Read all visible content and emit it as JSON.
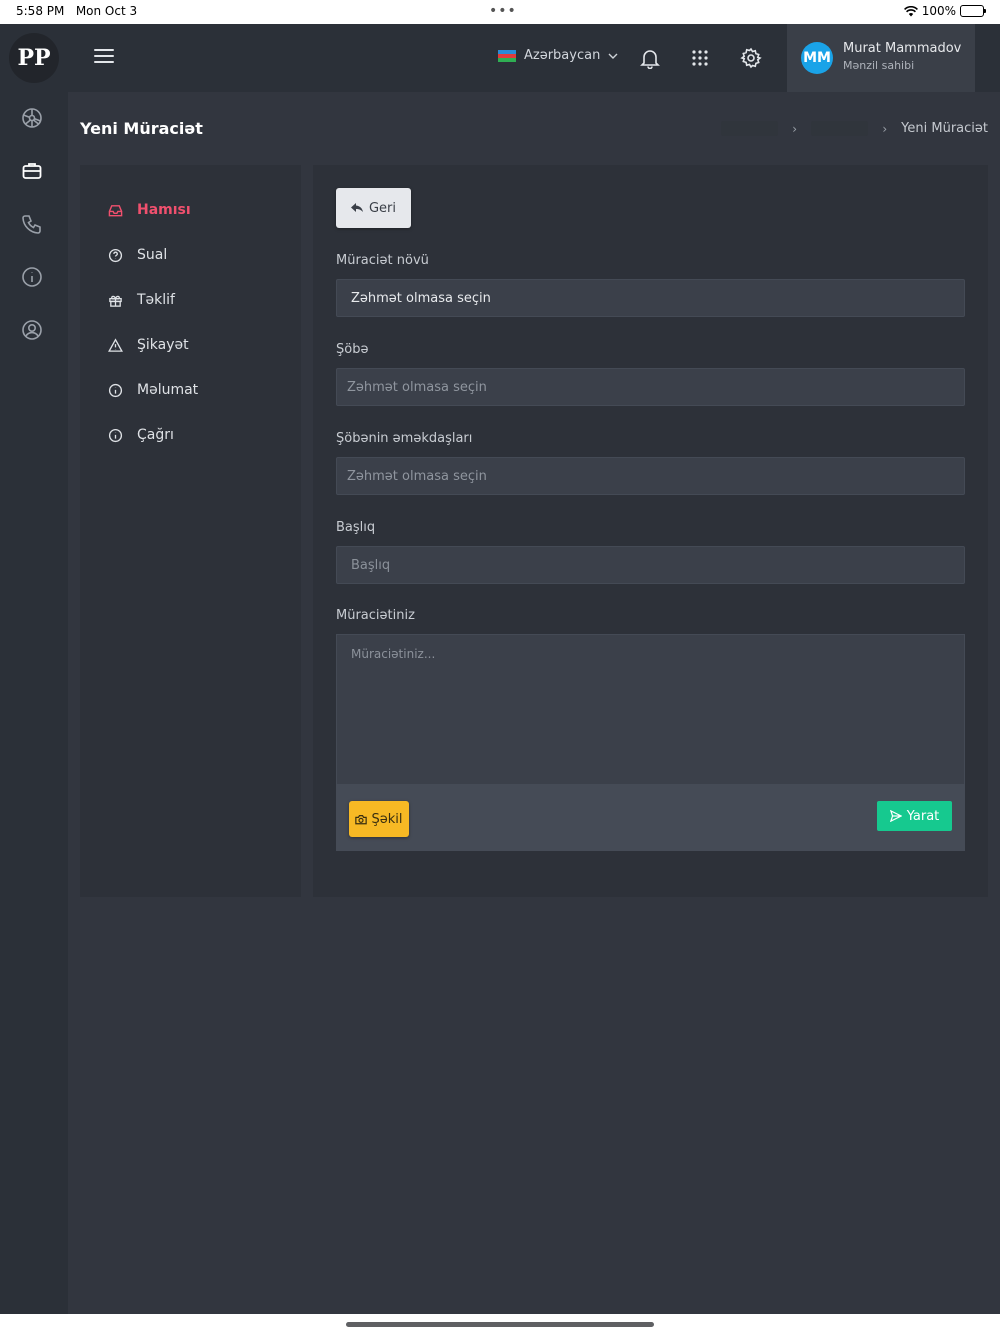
{
  "status_bar": {
    "time": "5:58 PM",
    "date": "Mon Oct 3",
    "battery": "100%"
  },
  "logo": {
    "text": "PP"
  },
  "rail": {
    "icons": [
      "dashboard-icon",
      "briefcase-icon",
      "phone-icon",
      "info-icon",
      "user-circle-icon"
    ]
  },
  "topbar": {
    "language": "Azərbaycan",
    "user": {
      "initials": "MM",
      "name": "Murat Mammadov",
      "role": "Mənzil sahibi"
    }
  },
  "page": {
    "title": "Yeni Müraciət",
    "breadcrumb": {
      "current": "Yeni Müraciət"
    }
  },
  "filters": {
    "items": [
      {
        "label": "Hamısı",
        "icon": "inbox-icon",
        "active": true
      },
      {
        "label": "Sual",
        "icon": "question-circle-icon",
        "active": false
      },
      {
        "label": "Təklif",
        "icon": "gift-icon",
        "active": false
      },
      {
        "label": "Şikayət",
        "icon": "warning-triangle-icon",
        "active": false
      },
      {
        "label": "Məlumat",
        "icon": "info-circle-icon",
        "active": false
      },
      {
        "label": "Çağrı",
        "icon": "info-circle-icon",
        "active": false
      }
    ]
  },
  "form": {
    "back_label": "Geri",
    "type_label": "Müraciət növü",
    "type_value": "Zəhmət olmasa seçin",
    "department_label": "Şöbə",
    "department_placeholder": "Zəhmət olmasa seçin",
    "employees_label": "Şöbənin əməkdaşları",
    "employees_placeholder": "Zəhmət olmasa seçin",
    "subject_label": "Başlıq",
    "subject_placeholder": "Başlıq",
    "message_label": "Müraciətiniz",
    "message_placeholder": "Müraciətiniz...",
    "photo_label": "Şəkil",
    "create_label": "Yarat"
  },
  "colors": {
    "accent_active": "#f0506e",
    "photo_button": "#f7b924",
    "create_button": "#16c98f",
    "avatar": "#1aa3e8"
  }
}
